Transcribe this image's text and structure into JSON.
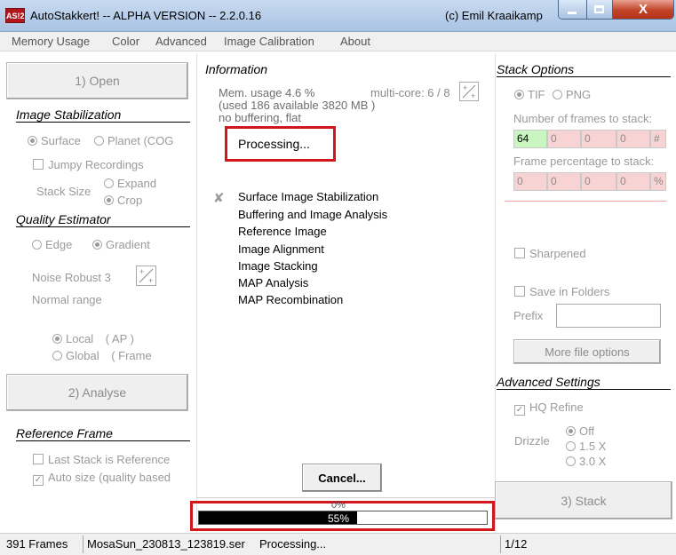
{
  "window": {
    "app_icon_text": "AS!2",
    "title": "AutoStakkert! -- ALPHA VERSION -- 2.2.0.16",
    "copyright": "(c) Emil Kraaikamp",
    "close_glyph": "X"
  },
  "menu": [
    "Memory Usage",
    "Color",
    "Advanced",
    "Image Calibration",
    "About"
  ],
  "left": {
    "open_button": "1) Open",
    "image_stabilization": {
      "title": "Image Stabilization",
      "option_surface": "Surface",
      "option_planet": "Planet (COG",
      "jumpy_recordings": "Jumpy Recordings",
      "stack_size_label": "Stack Size",
      "option_expand": "Expand",
      "option_crop": "Crop"
    },
    "quality_estimator": {
      "title": "Quality Estimator",
      "option_edge": "Edge",
      "option_gradient": "Gradient",
      "noise_robust": "Noise Robust 3",
      "normal_range": "Normal range",
      "option_local": "Local",
      "local_suffix": "( AP )",
      "option_global": "Global",
      "global_suffix": "( Frame"
    },
    "analyse_button": "2) Analyse",
    "reference_frame": {
      "title": "Reference Frame",
      "last_stack": "Last Stack is Reference",
      "auto_size": "Auto size (quality based"
    }
  },
  "center": {
    "information_title": "Information",
    "mem_usage": "Mem. usage 4.6 %",
    "multi_core": "multi-core: 6 / 8",
    "used_available": "(used 186 available 3820 MB )",
    "buffering": "no buffering, flat",
    "processing_label": "Processing...",
    "steps": [
      "Surface Image Stabilization",
      "Buffering and Image Analysis",
      "Reference Image",
      "Image Alignment",
      "Image Stacking",
      "MAP Analysis",
      "MAP Recombination"
    ],
    "cancel_button": "Cancel...",
    "progress_top_label": "0%",
    "progress_label": "55%",
    "progress_fraction": 0.55
  },
  "right": {
    "stack_options_title": "Stack Options",
    "format_tif": "TIF",
    "format_png": "PNG",
    "frames_to_stack_label": "Number of frames to stack:",
    "frames_values": [
      "64",
      "0",
      "0",
      "0"
    ],
    "frames_unit": "#",
    "frame_pct_label": "Frame percentage to stack:",
    "pct_values": [
      "0",
      "0",
      "0",
      "0"
    ],
    "pct_unit": "%",
    "sharpened": "Sharpened",
    "save_in_folders": "Save in Folders",
    "prefix_label": "Prefix",
    "prefix_value": "",
    "more_file_options": "More file options",
    "advanced_settings_title": "Advanced Settings",
    "hq_refine": "HQ Refine",
    "drizzle_label": "Drizzle",
    "drizzle_off": "Off",
    "drizzle_15": "1.5 X",
    "drizzle_30": "3.0 X",
    "stack_button": "3) Stack"
  },
  "status": {
    "frames": "391 Frames",
    "file": "MosaSun_230813_123819.ser",
    "state": "Processing...",
    "page": "1/12"
  },
  "colors": {
    "highlight": "#d3161b",
    "frames_active_bg": "#c9f5c0",
    "frames_inactive_bg": "#f7d3d3",
    "progress_fill": "#000000"
  }
}
